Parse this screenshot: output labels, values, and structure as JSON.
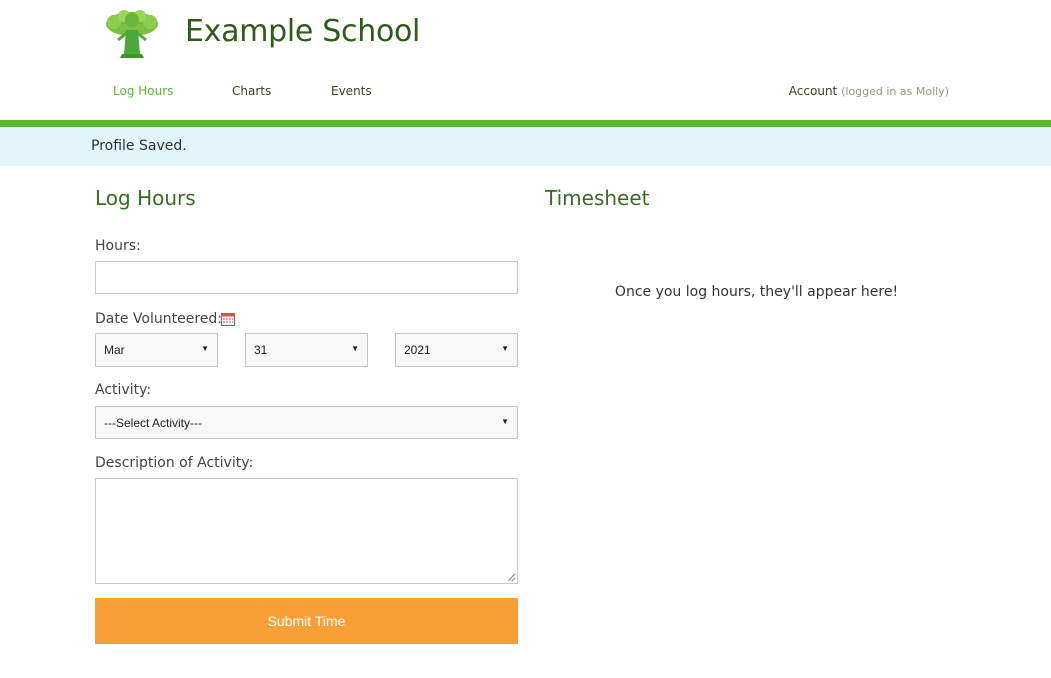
{
  "header": {
    "site_title": "Example School",
    "logo_icon": "tree-logo-icon"
  },
  "nav": {
    "items": [
      {
        "label": "Log Hours",
        "active": true
      },
      {
        "label": "Charts",
        "active": false
      },
      {
        "label": "Events",
        "active": false
      }
    ],
    "account_label": "Account",
    "account_note": "(logged in as Molly)"
  },
  "notice": {
    "text": "Profile Saved."
  },
  "log_hours": {
    "title": "Log Hours",
    "hours_label": "Hours:",
    "hours_value": "",
    "date_label": "Date Volunteered:",
    "date_icon": "calendar-icon",
    "month": "Mar",
    "day": "31",
    "year": "2021",
    "activity_label": "Activity:",
    "activity_selected": "---Select Activity---",
    "description_label": "Description of Activity:",
    "description_value": "",
    "submit_label": "Submit Time"
  },
  "timesheet": {
    "title": "Timesheet",
    "empty_message": "Once you log hours, they'll appear here!"
  },
  "colors": {
    "brand_green": "#5cb832",
    "title_green": "#2f5a1a",
    "notice_bg": "#e0f6fa",
    "submit_orange": "#f8a036"
  }
}
